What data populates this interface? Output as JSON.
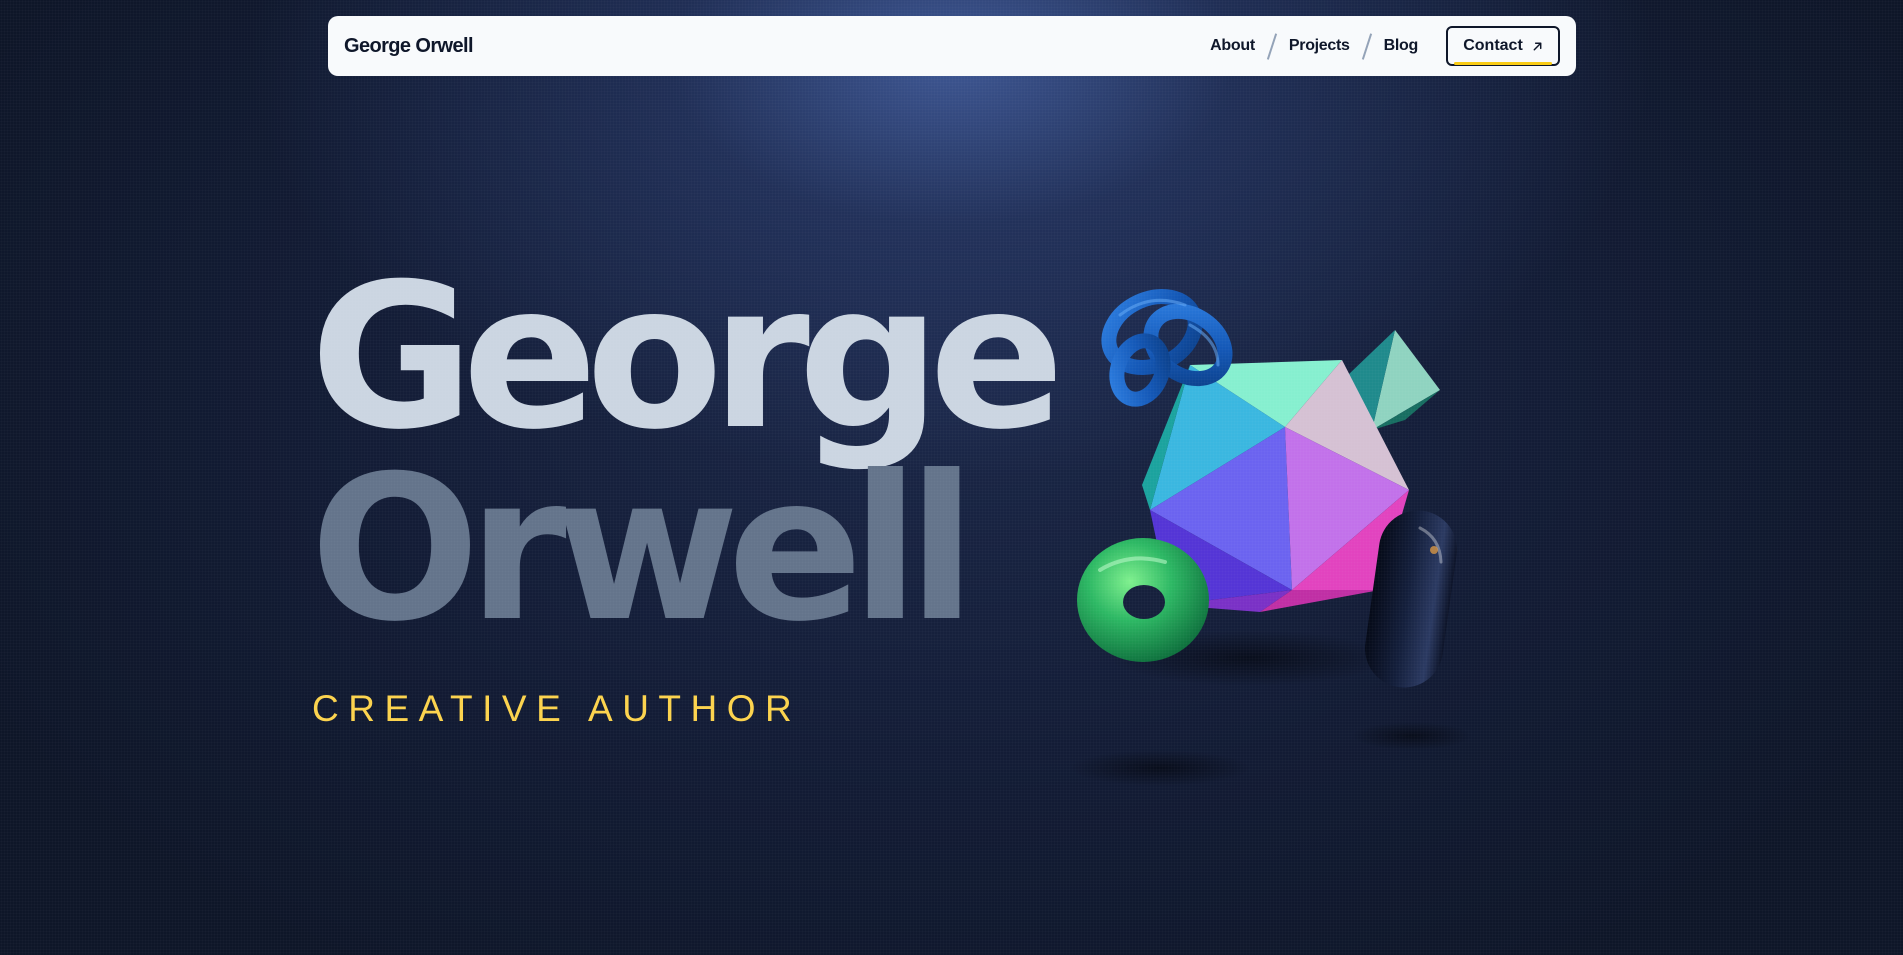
{
  "nav": {
    "brand": "George Orwell",
    "links": [
      {
        "label": "About"
      },
      {
        "label": "Projects"
      },
      {
        "label": "Blog"
      }
    ],
    "contact_label": "Contact",
    "contact_icon": "arrow-up-right-icon",
    "accent": "#facc15"
  },
  "hero": {
    "first_name": "George",
    "last_name": "Orwell",
    "tagline": "CREATIVE AUTHOR"
  },
  "colors": {
    "background": "#0f172a",
    "nav_background": "#f8fafc",
    "first_name": "#cbd5e1",
    "last_name": "#64748b",
    "tagline": "#fcd34d"
  },
  "illustration": {
    "shapes": [
      "knot-icon",
      "icosahedron-icon",
      "pyramid-icon",
      "torus-icon",
      "capsule-icon"
    ]
  }
}
